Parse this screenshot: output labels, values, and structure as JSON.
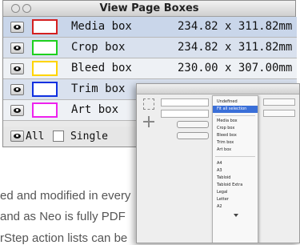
{
  "window": {
    "title": "View Page Boxes"
  },
  "boxes": [
    {
      "name": "Media box",
      "dimensions": "234.82 x 311.82mm",
      "color": "#d42020"
    },
    {
      "name": "Crop box",
      "dimensions": "234.82 x 311.82mm",
      "color": "#1ed01e"
    },
    {
      "name": "Bleed box",
      "dimensions": "230.00 x 307.00mm",
      "color": "#ffd400"
    },
    {
      "name": "Trim box",
      "dimensions": "",
      "color": "#1030e0"
    },
    {
      "name": "Art box",
      "dimensions": "",
      "color": "#ee22ee"
    }
  ],
  "footer": {
    "all_label": "All",
    "single_label": "Single"
  },
  "dialog": {
    "menu": {
      "items_top": [
        "Undefined",
        "Fit all selection"
      ],
      "items_boxes": [
        "Media box",
        "Crop box",
        "Bleed box",
        "Trim box",
        "Art box"
      ],
      "items_sizes": [
        "A4",
        "A3",
        "Tabloid",
        "Tabloid Extra",
        "Legal",
        "Letter",
        "A2"
      ]
    }
  },
  "body_text": {
    "line1": "ed and modified in every",
    "line2": " and as Neo is fully PDF",
    "line3": "rStep action lists can be"
  }
}
